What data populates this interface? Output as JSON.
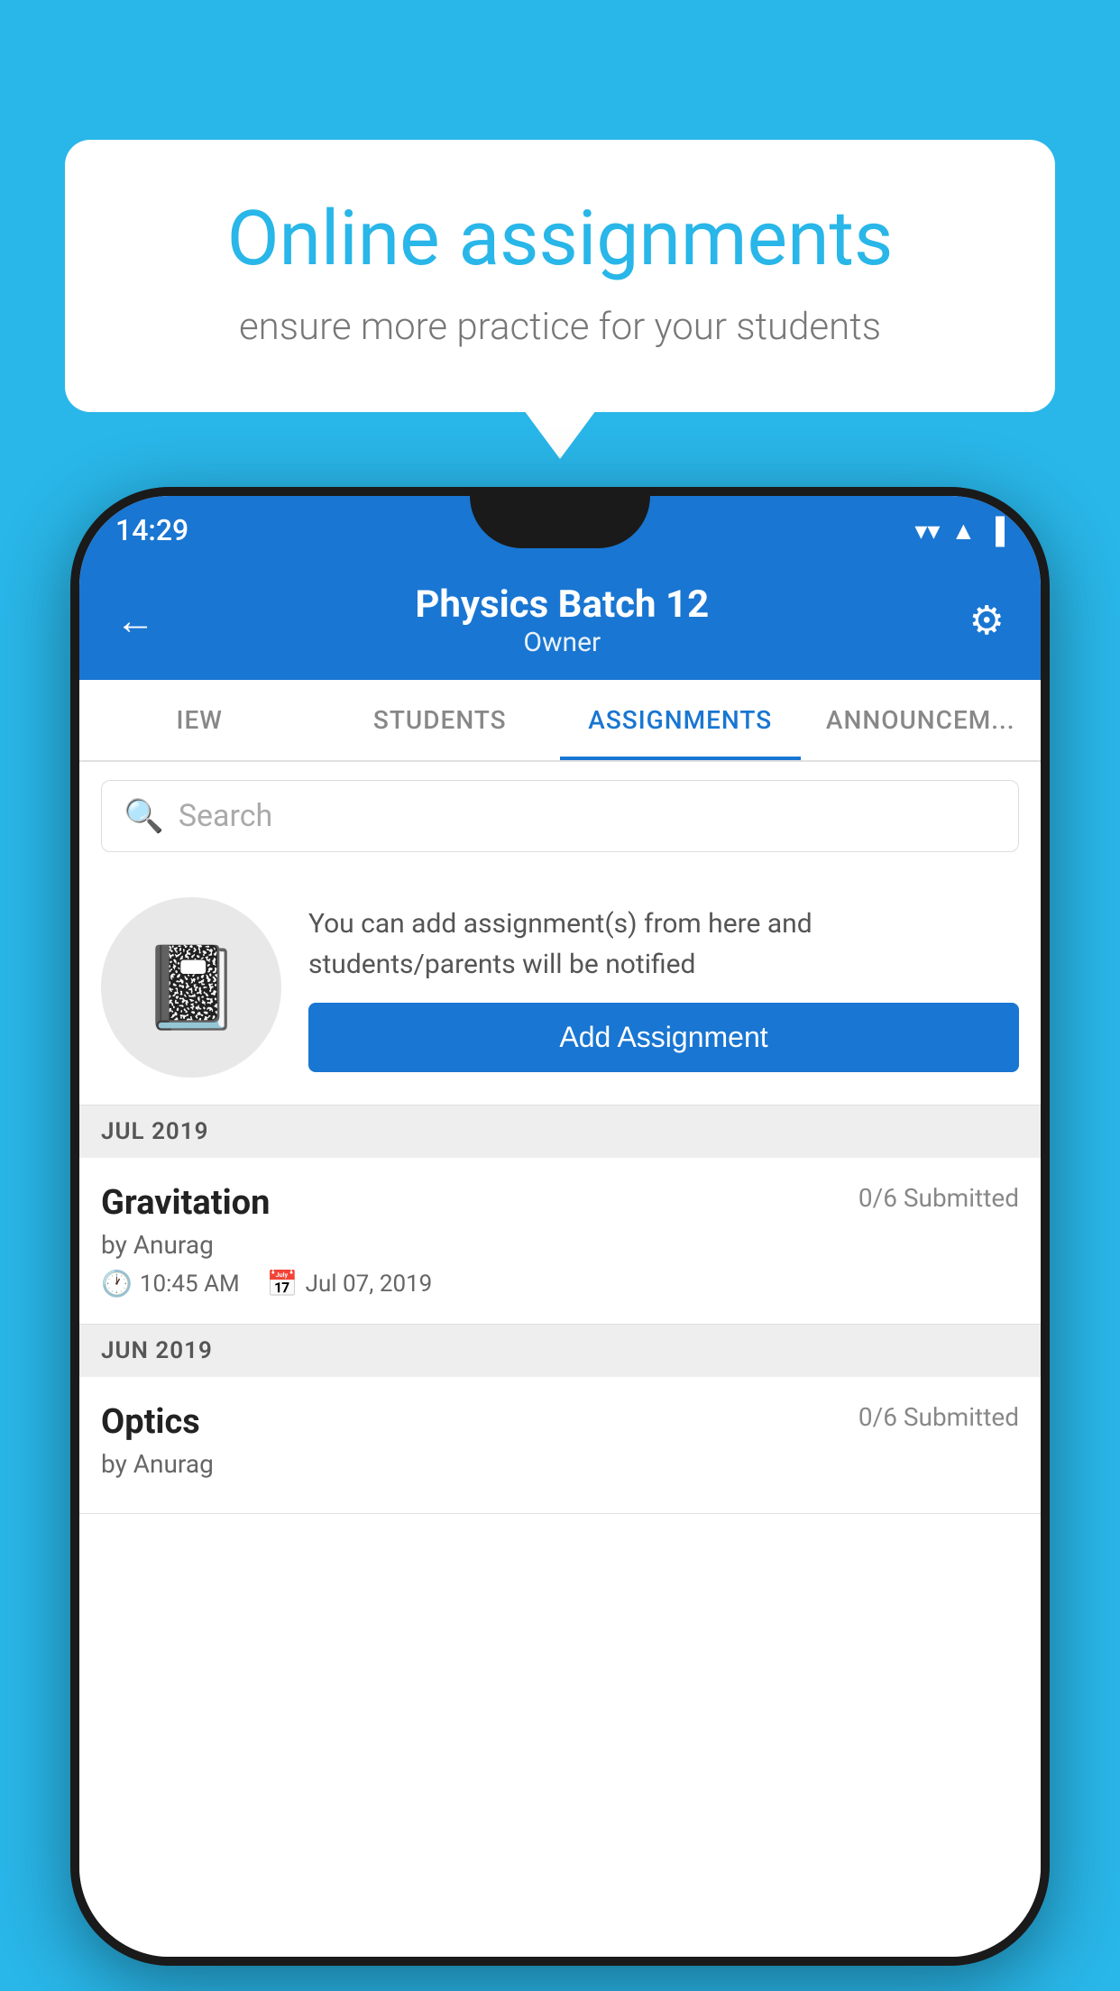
{
  "background_color": "#29b6e8",
  "speech_bubble": {
    "title": "Online assignments",
    "subtitle": "ensure more practice for your students"
  },
  "phone": {
    "status_bar": {
      "time": "14:29",
      "wifi": "▼",
      "signal": "▲",
      "battery": "▌"
    },
    "app_bar": {
      "back_label": "←",
      "title": "Physics Batch 12",
      "subtitle": "Owner",
      "settings_label": "⚙"
    },
    "tabs": [
      {
        "label": "IEW",
        "active": false
      },
      {
        "label": "STUDENTS",
        "active": false
      },
      {
        "label": "ASSIGNMENTS",
        "active": true
      },
      {
        "label": "ANNOUNCEM...",
        "active": false
      }
    ],
    "search": {
      "placeholder": "Search"
    },
    "promo": {
      "text": "You can add assignment(s) from here and students/parents will be notified",
      "button_label": "Add Assignment"
    },
    "sections": [
      {
        "header": "JUL 2019",
        "assignments": [
          {
            "name": "Gravitation",
            "submitted": "0/6 Submitted",
            "by": "by Anurag",
            "time": "10:45 AM",
            "date": "Jul 07, 2019"
          }
        ]
      },
      {
        "header": "JUN 2019",
        "assignments": [
          {
            "name": "Optics",
            "submitted": "0/6 Submitted",
            "by": "by Anurag",
            "time": "",
            "date": ""
          }
        ]
      }
    ]
  }
}
